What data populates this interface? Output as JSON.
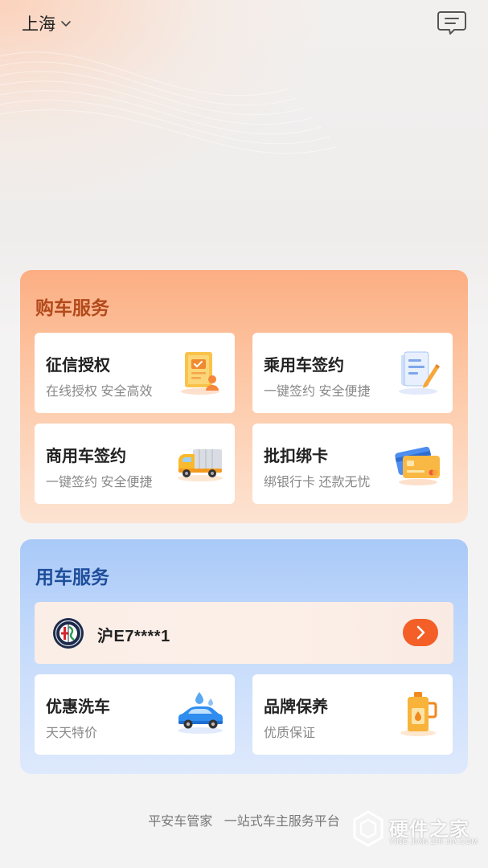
{
  "header": {
    "city": "上海",
    "icons": {
      "city_dropdown": "chevron-down-icon",
      "messages": "message-icon"
    }
  },
  "buy_service": {
    "title": "购车服务",
    "tiles": [
      {
        "title": "征信授权",
        "subtitle": "在线授权 安全高效",
        "icon": "credit-authorization-icon"
      },
      {
        "title": "乘用车签约",
        "subtitle": "一键签约 安全便捷",
        "icon": "contract-signing-icon"
      },
      {
        "title": "商用车签约",
        "subtitle": "一键签约 安全便捷",
        "icon": "truck-icon"
      },
      {
        "title": "批扣绑卡",
        "subtitle": "绑银行卡 还款无忧",
        "icon": "bank-card-icon"
      }
    ]
  },
  "use_service": {
    "title": "用车服务",
    "vehicle": {
      "plate": "沪E7****1",
      "brand_logo": "alfa-romeo-logo"
    },
    "tiles": [
      {
        "title": "优惠洗车",
        "subtitle": "天天特价",
        "icon": "car-wash-icon"
      },
      {
        "title": "品牌保养",
        "subtitle": "优质保证",
        "icon": "engine-oil-icon"
      }
    ]
  },
  "footer": {
    "brand": "平安车管家",
    "slogan": "一站式车主服务平台"
  },
  "watermark": {
    "text": "硬件之家",
    "subtext": "YING JIAN ZHI JIA.COM"
  },
  "colors": {
    "buy_card_top": "#fcae82",
    "use_card_top": "#a9c9f8",
    "accent_orange": "#f35f27",
    "buy_title": "#b24a1c",
    "use_title": "#1e4d9a"
  }
}
